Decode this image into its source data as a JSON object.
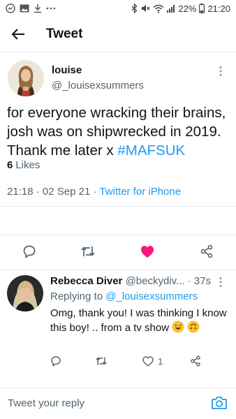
{
  "status_bar": {
    "icons_left": [
      "messenger-icon",
      "image-icon",
      "download-icon",
      "more-dots-icon"
    ],
    "icons_right": [
      "bluetooth-icon",
      "mute-icon",
      "wifi-icon",
      "signal-icon",
      "battery-icon"
    ],
    "battery": "22%",
    "time": "21:20"
  },
  "header": {
    "title": "Tweet"
  },
  "tweet": {
    "author_name": "louise",
    "author_handle": "@_louisexsummers",
    "text": "for everyone wracking their brains, josh was on shipwrecked in 2019. Thank me later x ",
    "hashtag": "#MAFSUK",
    "time": "21:18",
    "sep1": " · ",
    "date": "02 Sep 21",
    "sep2": " · ",
    "source": "Twitter for iPhone",
    "likes_count": "6",
    "likes_label": "Likes"
  },
  "reply": {
    "name": "Rebecca Diver",
    "handle": "@beckydiv...",
    "time": " · 37s",
    "replying_prefix": "Replying to ",
    "replying_to": "@_louisexsummers",
    "text": "Omg, thank you! I was thinking I know this boy! .. from a tv show ",
    "like_count": "1"
  },
  "compose": {
    "placeholder": "Tweet your reply"
  },
  "colors": {
    "accent": "#1d9bf0",
    "like": "#f91880",
    "muted": "#536471"
  }
}
